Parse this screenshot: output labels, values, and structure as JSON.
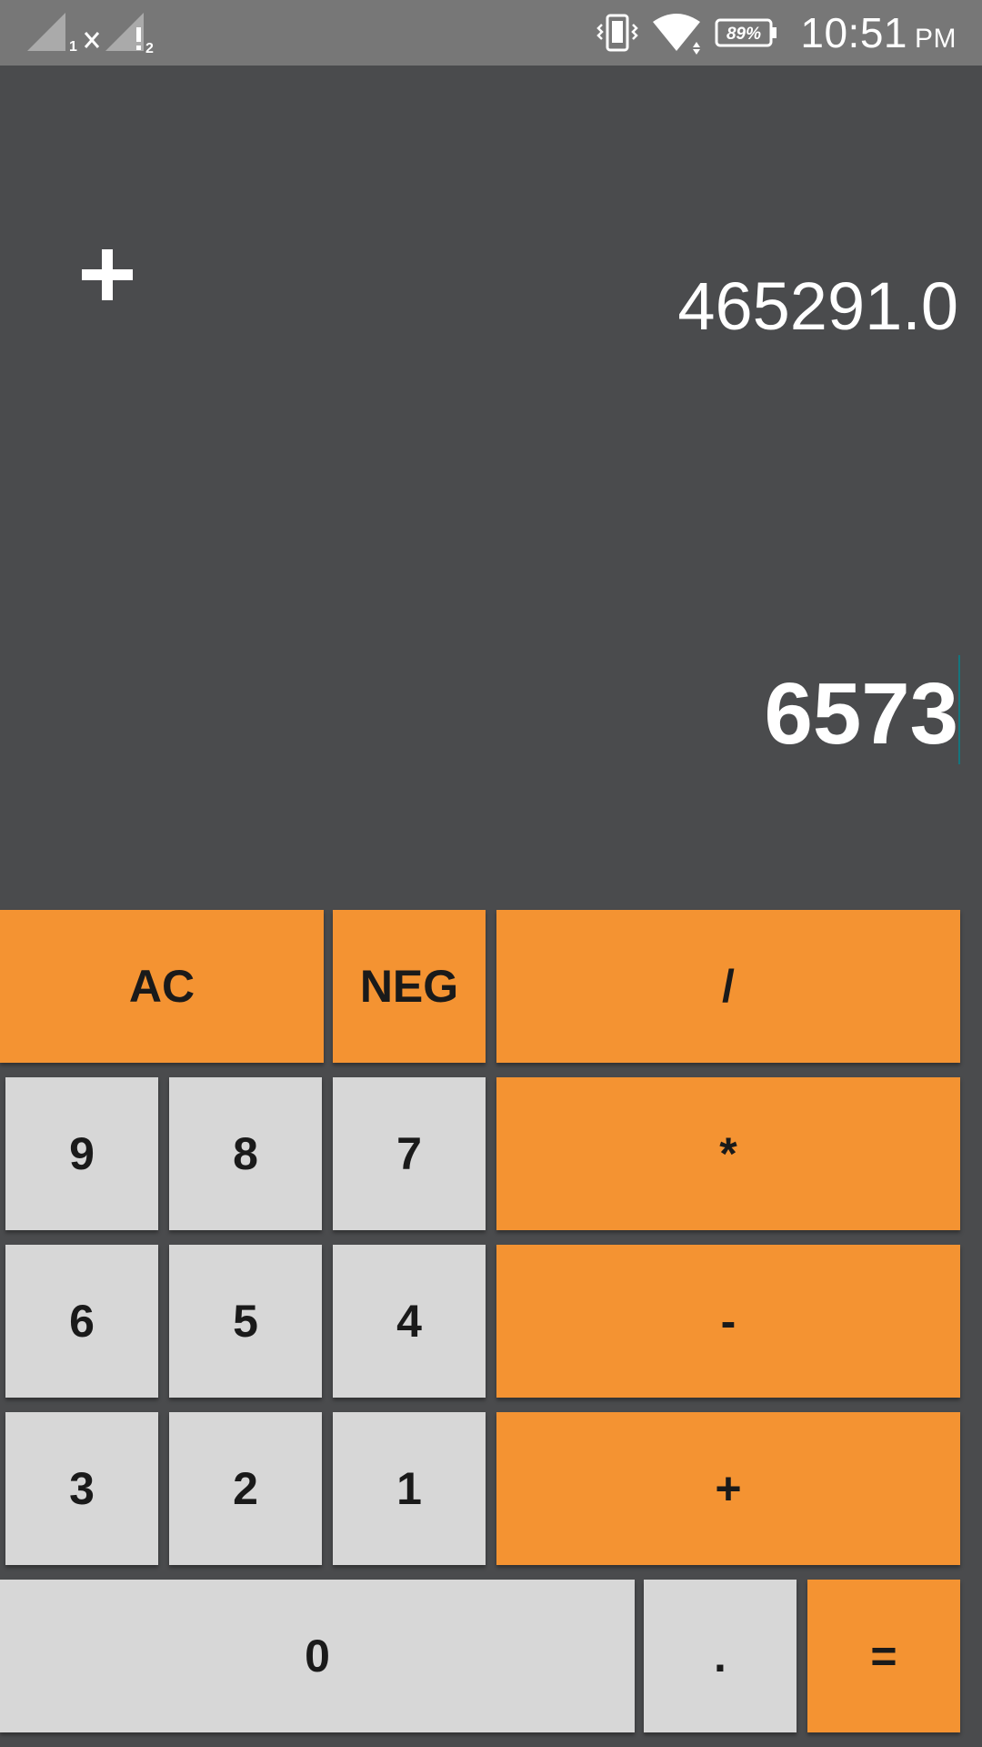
{
  "status_bar": {
    "sim1_label": "1",
    "sim2_label": "2",
    "battery_percent": "89%",
    "time": "10:51",
    "ampm": "PM",
    "icons": [
      "signal-sim1-icon",
      "no-data-icon",
      "signal-sim2-icon",
      "vibrate-icon",
      "wifi-icon",
      "battery-icon"
    ]
  },
  "display": {
    "operator_symbol": "+",
    "previous_value": "465291.0",
    "current_value": "6573"
  },
  "keypad": {
    "ac": "AC",
    "neg": "NEG",
    "divide": "/",
    "multiply": "*",
    "subtract": "-",
    "add": "+",
    "equals": "=",
    "decimal": ".",
    "d0": "0",
    "d1": "1",
    "d2": "2",
    "d3": "3",
    "d4": "4",
    "d5": "5",
    "d6": "6",
    "d7": "7",
    "d8": "8",
    "d9": "9"
  },
  "colors": {
    "background": "#4a4b4d",
    "status_bar": "#777777",
    "operator_key": "#f49332",
    "digit_key": "#d7d7d7",
    "cursor": "#15757e"
  }
}
